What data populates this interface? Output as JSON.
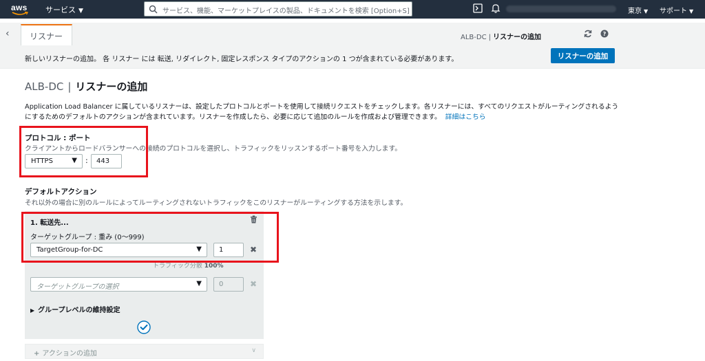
{
  "topnav": {
    "logo": "aws",
    "services_label": "サービス",
    "search_placeholder": "サービス、機能、マーケットプレイスの製品、ドキュメントを検索 [Option+S]",
    "region_label": "東京",
    "support_label": "サポート"
  },
  "tabbar": {
    "active_tab": "リスナー",
    "breadcrumb_parent": "ALB-DC",
    "breadcrumb_separator": "|",
    "breadcrumb_current": "リスナーの追加"
  },
  "infobar": {
    "message": "新しいリスナーの追加。 各 リスナー には 転送, リダイレクト, 固定レスポンス タイプのアクションの 1 つが含まれている必要があります。",
    "add_button": "リスナーの追加"
  },
  "main": {
    "title_prefix": "ALB-DC",
    "title_separator": "|",
    "title": "リスナーの追加",
    "description": "Application Load Balancer に属しているリスナーは、設定したプロトコルとポートを使用して接続リクエストをチェックします。各リスナーには、すべてのリクエストがルーティングされるようにするためのデフォルトのアクションが含まれています。リスナーを作成したら、必要に応じて追加のルールを作成および管理できます。",
    "details_link": "詳細はこちら"
  },
  "protocol": {
    "title": "プロトコル : ポート",
    "description": "クライアントからロードバランサーへの接続のプロトコルを選択し、トラフィックをリッスンするポート番号を入力します。",
    "selected": "HTTPS",
    "separator": ":",
    "port": "443"
  },
  "default_action": {
    "title": "デフォルトアクション",
    "description": "それ以外の場合に別のルールによってルーティングされないトラフィックをこのリスナーがルーティングする方法を示します。",
    "action_title": "1. 転送先...",
    "target_group_label": "ターゲットグループ : 重み (0〜999)",
    "target_group_selected": "TargetGroup-for-DC",
    "weight": "1",
    "traffic_label": "トラフィック分散",
    "traffic_value": "100%",
    "target_group_placeholder": "ターゲットグループの選択",
    "weight_empty": "0",
    "group_stickiness": "グループレベルの維持設定",
    "add_action": "アクションの追加"
  },
  "colors": {
    "nav_bg": "#232f3e",
    "accent": "#ec7211",
    "primary": "#0073bb",
    "highlight": "#e8131c"
  }
}
